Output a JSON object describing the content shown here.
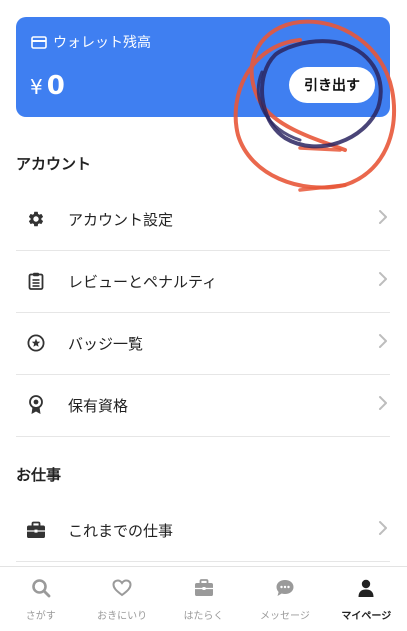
{
  "wallet": {
    "label": "ウォレット残高",
    "currency": "¥",
    "amount": "0",
    "withdraw_label": "引き出す",
    "color": "#3f7ff1"
  },
  "account_section": {
    "title": "アカウント",
    "items": [
      {
        "label": "アカウント設定",
        "icon": "gear-icon"
      },
      {
        "label": "レビューとペナルティ",
        "icon": "clipboard-icon"
      },
      {
        "label": "バッジ一覧",
        "icon": "star-badge-icon"
      },
      {
        "label": "保有資格",
        "icon": "award-ribbon-icon"
      }
    ]
  },
  "work_section": {
    "title": "お仕事",
    "items": [
      {
        "label": "これまでの仕事",
        "icon": "briefcase-icon"
      }
    ]
  },
  "tabbar": {
    "tabs": [
      {
        "label": "さがす",
        "icon": "search-icon",
        "active": false
      },
      {
        "label": "おきにいり",
        "icon": "heart-icon",
        "active": false
      },
      {
        "label": "はたらく",
        "icon": "briefcase-icon",
        "active": false
      },
      {
        "label": "メッセージ",
        "icon": "chat-bubble-icon",
        "active": false
      },
      {
        "label": "マイページ",
        "icon": "person-icon",
        "active": true
      }
    ]
  },
  "annotation_color": "#e8583a"
}
